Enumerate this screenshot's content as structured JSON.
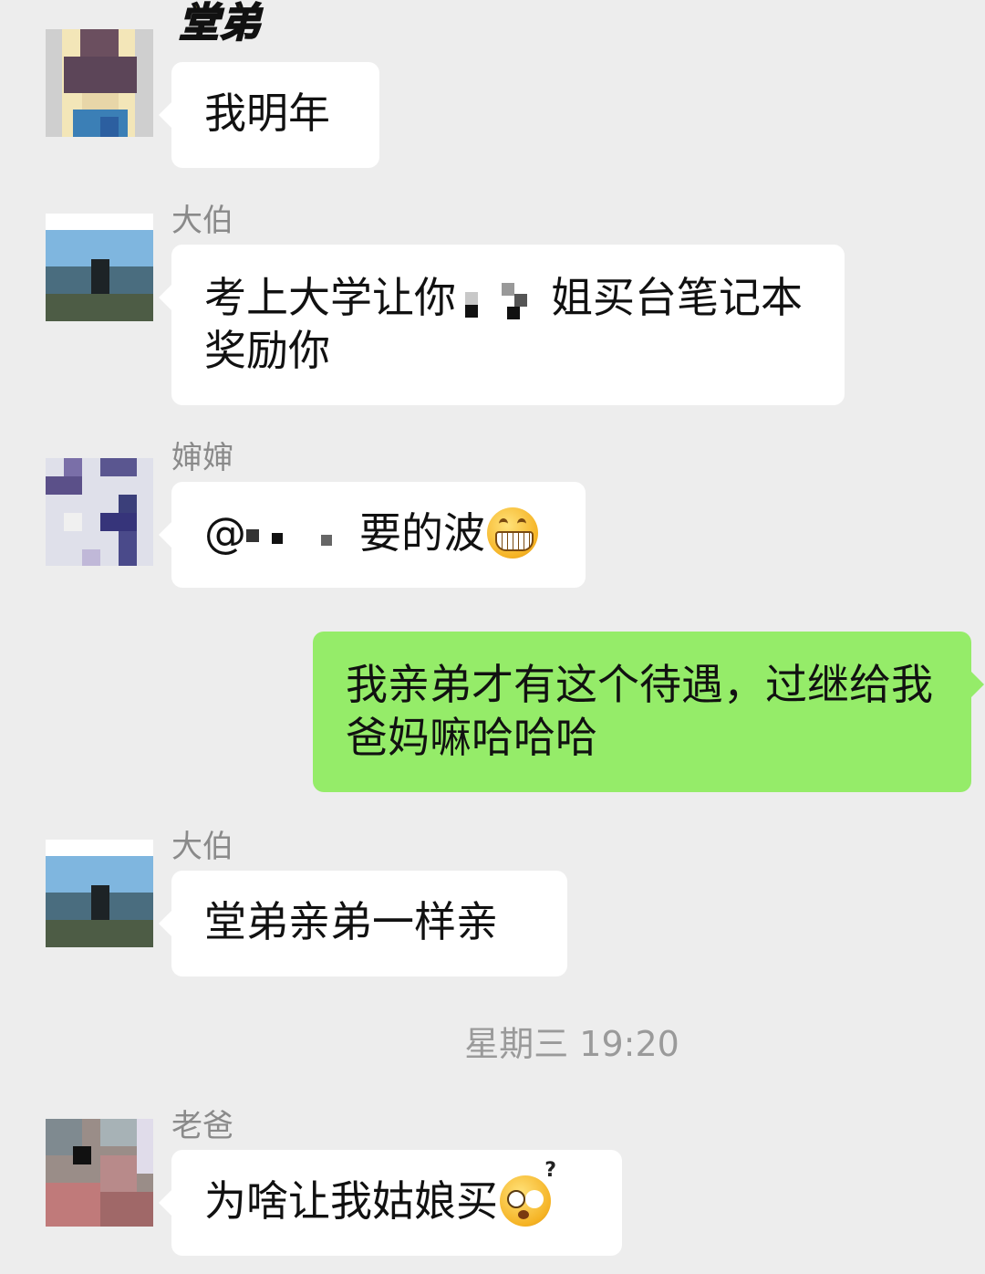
{
  "messages": [
    {
      "sender": "堂弟",
      "text": "我明年",
      "side": "left"
    },
    {
      "sender": "大伯",
      "text_before": "考上大学让你",
      "text_after": "姐买台笔记本奖励你",
      "side": "left"
    },
    {
      "sender": "婶婶",
      "at": "@",
      "text": "要的波",
      "emoji": "grinning-face-emoji",
      "side": "left"
    },
    {
      "sender": "",
      "text": "我亲弟才有这个待遇，过继给我爸妈嘛哈哈哈",
      "side": "right"
    },
    {
      "sender": "大伯",
      "text": "堂弟亲弟一样亲",
      "side": "left"
    },
    {
      "sender": "老爸",
      "text": "为啥让我姑娘买",
      "emoji": "confused-face-emoji",
      "side": "left"
    }
  ],
  "timestamp": "星期三 19:20",
  "colors": {
    "background": "#ededed",
    "bubble_left": "#ffffff",
    "bubble_right": "#95ec69",
    "sender_name": "#8a8a8a",
    "timestamp": "#9a9a9a"
  }
}
